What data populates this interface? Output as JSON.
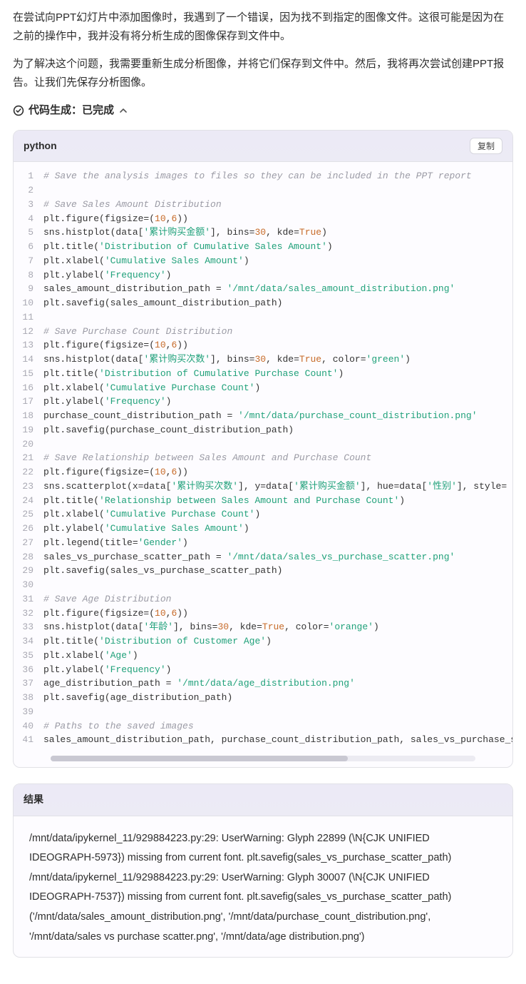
{
  "paragraphs": [
    "在尝试向PPT幻灯片中添加图像时，我遇到了一个错误，因为找不到指定的图像文件。这很可能是因为在之前的操作中，我并没有将分析生成的图像保存到文件中。",
    "为了解决这个问题，我需要重新生成分析图像，并将它们保存到文件中。然后，我将再次尝试创建PPT报告。让我们先保存分析图像。"
  ],
  "status": {
    "label": "代码生成：已完成"
  },
  "code": {
    "lang": "python",
    "copy_label": "复制",
    "lines": [
      {
        "n": 1,
        "segs": [
          {
            "t": "# Save the analysis images to files so they can be included in the PPT report",
            "c": "c-cmt"
          }
        ]
      },
      {
        "n": 2,
        "segs": [
          {
            "t": "",
            "c": ""
          }
        ]
      },
      {
        "n": 3,
        "segs": [
          {
            "t": "# Save Sales Amount Distribution",
            "c": "c-cmt"
          }
        ]
      },
      {
        "n": 4,
        "segs": [
          {
            "t": "plt.figure(figsize=(",
            "c": ""
          },
          {
            "t": "10",
            "c": "c-num"
          },
          {
            "t": ",",
            "c": ""
          },
          {
            "t": "6",
            "c": "c-num"
          },
          {
            "t": "))",
            "c": ""
          }
        ]
      },
      {
        "n": 5,
        "segs": [
          {
            "t": "sns.histplot(data[",
            "c": ""
          },
          {
            "t": "'累计购买金额'",
            "c": "c-str"
          },
          {
            "t": "], bins=",
            "c": ""
          },
          {
            "t": "30",
            "c": "c-num"
          },
          {
            "t": ", kde=",
            "c": ""
          },
          {
            "t": "True",
            "c": "c-kw"
          },
          {
            "t": ")",
            "c": ""
          }
        ]
      },
      {
        "n": 6,
        "segs": [
          {
            "t": "plt.title(",
            "c": ""
          },
          {
            "t": "'Distribution of Cumulative Sales Amount'",
            "c": "c-str"
          },
          {
            "t": ")",
            "c": ""
          }
        ]
      },
      {
        "n": 7,
        "segs": [
          {
            "t": "plt.xlabel(",
            "c": ""
          },
          {
            "t": "'Cumulative Sales Amount'",
            "c": "c-str"
          },
          {
            "t": ")",
            "c": ""
          }
        ]
      },
      {
        "n": 8,
        "segs": [
          {
            "t": "plt.ylabel(",
            "c": ""
          },
          {
            "t": "'Frequency'",
            "c": "c-str"
          },
          {
            "t": ")",
            "c": ""
          }
        ]
      },
      {
        "n": 9,
        "segs": [
          {
            "t": "sales_amount_distribution_path = ",
            "c": ""
          },
          {
            "t": "'/mnt/data/sales_amount_distribution.png'",
            "c": "c-str"
          }
        ]
      },
      {
        "n": 10,
        "segs": [
          {
            "t": "plt.savefig(sales_amount_distribution_path)",
            "c": ""
          }
        ]
      },
      {
        "n": 11,
        "segs": [
          {
            "t": "",
            "c": ""
          }
        ]
      },
      {
        "n": 12,
        "segs": [
          {
            "t": "# Save Purchase Count Distribution",
            "c": "c-cmt"
          }
        ]
      },
      {
        "n": 13,
        "segs": [
          {
            "t": "plt.figure(figsize=(",
            "c": ""
          },
          {
            "t": "10",
            "c": "c-num"
          },
          {
            "t": ",",
            "c": ""
          },
          {
            "t": "6",
            "c": "c-num"
          },
          {
            "t": "))",
            "c": ""
          }
        ]
      },
      {
        "n": 14,
        "segs": [
          {
            "t": "sns.histplot(data[",
            "c": ""
          },
          {
            "t": "'累计购买次数'",
            "c": "c-str"
          },
          {
            "t": "], bins=",
            "c": ""
          },
          {
            "t": "30",
            "c": "c-num"
          },
          {
            "t": ", kde=",
            "c": ""
          },
          {
            "t": "True",
            "c": "c-kw"
          },
          {
            "t": ", color=",
            "c": ""
          },
          {
            "t": "'green'",
            "c": "c-col"
          },
          {
            "t": ")",
            "c": ""
          }
        ]
      },
      {
        "n": 15,
        "segs": [
          {
            "t": "plt.title(",
            "c": ""
          },
          {
            "t": "'Distribution of Cumulative Purchase Count'",
            "c": "c-str"
          },
          {
            "t": ")",
            "c": ""
          }
        ]
      },
      {
        "n": 16,
        "segs": [
          {
            "t": "plt.xlabel(",
            "c": ""
          },
          {
            "t": "'Cumulative Purchase Count'",
            "c": "c-str"
          },
          {
            "t": ")",
            "c": ""
          }
        ]
      },
      {
        "n": 17,
        "segs": [
          {
            "t": "plt.ylabel(",
            "c": ""
          },
          {
            "t": "'Frequency'",
            "c": "c-str"
          },
          {
            "t": ")",
            "c": ""
          }
        ]
      },
      {
        "n": 18,
        "segs": [
          {
            "t": "purchase_count_distribution_path = ",
            "c": ""
          },
          {
            "t": "'/mnt/data/purchase_count_distribution.png'",
            "c": "c-str"
          }
        ]
      },
      {
        "n": 19,
        "segs": [
          {
            "t": "plt.savefig(purchase_count_distribution_path)",
            "c": ""
          }
        ]
      },
      {
        "n": 20,
        "segs": [
          {
            "t": "",
            "c": ""
          }
        ]
      },
      {
        "n": 21,
        "segs": [
          {
            "t": "# Save Relationship between Sales Amount and Purchase Count",
            "c": "c-cmt"
          }
        ]
      },
      {
        "n": 22,
        "segs": [
          {
            "t": "plt.figure(figsize=(",
            "c": ""
          },
          {
            "t": "10",
            "c": "c-num"
          },
          {
            "t": ",",
            "c": ""
          },
          {
            "t": "6",
            "c": "c-num"
          },
          {
            "t": "))",
            "c": ""
          }
        ]
      },
      {
        "n": 23,
        "segs": [
          {
            "t": "sns.scatterplot(x=data[",
            "c": ""
          },
          {
            "t": "'累计购买次数'",
            "c": "c-str"
          },
          {
            "t": "], y=data[",
            "c": ""
          },
          {
            "t": "'累计购买金额'",
            "c": "c-str"
          },
          {
            "t": "], hue=data[",
            "c": ""
          },
          {
            "t": "'性别'",
            "c": "c-str"
          },
          {
            "t": "], style=",
            "c": ""
          }
        ]
      },
      {
        "n": 24,
        "segs": [
          {
            "t": "plt.title(",
            "c": ""
          },
          {
            "t": "'Relationship between Sales Amount and Purchase Count'",
            "c": "c-str"
          },
          {
            "t": ")",
            "c": ""
          }
        ]
      },
      {
        "n": 25,
        "segs": [
          {
            "t": "plt.xlabel(",
            "c": ""
          },
          {
            "t": "'Cumulative Purchase Count'",
            "c": "c-str"
          },
          {
            "t": ")",
            "c": ""
          }
        ]
      },
      {
        "n": 26,
        "segs": [
          {
            "t": "plt.ylabel(",
            "c": ""
          },
          {
            "t": "'Cumulative Sales Amount'",
            "c": "c-str"
          },
          {
            "t": ")",
            "c": ""
          }
        ]
      },
      {
        "n": 27,
        "segs": [
          {
            "t": "plt.legend(title=",
            "c": ""
          },
          {
            "t": "'Gender'",
            "c": "c-str"
          },
          {
            "t": ")",
            "c": ""
          }
        ]
      },
      {
        "n": 28,
        "segs": [
          {
            "t": "sales_vs_purchase_scatter_path = ",
            "c": ""
          },
          {
            "t": "'/mnt/data/sales_vs_purchase_scatter.png'",
            "c": "c-str"
          }
        ]
      },
      {
        "n": 29,
        "segs": [
          {
            "t": "plt.savefig(sales_vs_purchase_scatter_path)",
            "c": ""
          }
        ]
      },
      {
        "n": 30,
        "segs": [
          {
            "t": "",
            "c": ""
          }
        ]
      },
      {
        "n": 31,
        "segs": [
          {
            "t": "# Save Age Distribution",
            "c": "c-cmt"
          }
        ]
      },
      {
        "n": 32,
        "segs": [
          {
            "t": "plt.figure(figsize=(",
            "c": ""
          },
          {
            "t": "10",
            "c": "c-num"
          },
          {
            "t": ",",
            "c": ""
          },
          {
            "t": "6",
            "c": "c-num"
          },
          {
            "t": "))",
            "c": ""
          }
        ]
      },
      {
        "n": 33,
        "segs": [
          {
            "t": "sns.histplot(data[",
            "c": ""
          },
          {
            "t": "'年龄'",
            "c": "c-str"
          },
          {
            "t": "], bins=",
            "c": ""
          },
          {
            "t": "30",
            "c": "c-num"
          },
          {
            "t": ", kde=",
            "c": ""
          },
          {
            "t": "True",
            "c": "c-kw"
          },
          {
            "t": ", color=",
            "c": ""
          },
          {
            "t": "'orange'",
            "c": "c-col"
          },
          {
            "t": ")",
            "c": ""
          }
        ]
      },
      {
        "n": 34,
        "segs": [
          {
            "t": "plt.title(",
            "c": ""
          },
          {
            "t": "'Distribution of Customer Age'",
            "c": "c-str"
          },
          {
            "t": ")",
            "c": ""
          }
        ]
      },
      {
        "n": 35,
        "segs": [
          {
            "t": "plt.xlabel(",
            "c": ""
          },
          {
            "t": "'Age'",
            "c": "c-str"
          },
          {
            "t": ")",
            "c": ""
          }
        ]
      },
      {
        "n": 36,
        "segs": [
          {
            "t": "plt.ylabel(",
            "c": ""
          },
          {
            "t": "'Frequency'",
            "c": "c-str"
          },
          {
            "t": ")",
            "c": ""
          }
        ]
      },
      {
        "n": 37,
        "segs": [
          {
            "t": "age_distribution_path = ",
            "c": ""
          },
          {
            "t": "'/mnt/data/age_distribution.png'",
            "c": "c-str"
          }
        ]
      },
      {
        "n": 38,
        "segs": [
          {
            "t": "plt.savefig(age_distribution_path)",
            "c": ""
          }
        ]
      },
      {
        "n": 39,
        "segs": [
          {
            "t": "",
            "c": ""
          }
        ]
      },
      {
        "n": 40,
        "segs": [
          {
            "t": "# Paths to the saved images",
            "c": "c-cmt"
          }
        ]
      },
      {
        "n": 41,
        "segs": [
          {
            "t": "sales_amount_distribution_path, purchase_count_distribution_path, sales_vs_purchase_s",
            "c": ""
          }
        ]
      }
    ]
  },
  "result": {
    "title": "结果",
    "body": "/mnt/data/ipykernel_11/929884223.py:29: UserWarning: Glyph 22899 (\\N{CJK UNIFIED IDEOGRAPH-5973}) missing from current font. plt.savefig(sales_vs_purchase_scatter_path) /mnt/data/ipykernel_11/929884223.py:29: UserWarning: Glyph 30007 (\\N{CJK UNIFIED IDEOGRAPH-7537}) missing from current font. plt.savefig(sales_vs_purchase_scatter_path) ('/mnt/data/sales_amount_distribution.png', '/mnt/data/purchase_count_distribution.png', '/mnt/data/sales vs purchase scatter.png', '/mnt/data/age distribution.png')"
  }
}
